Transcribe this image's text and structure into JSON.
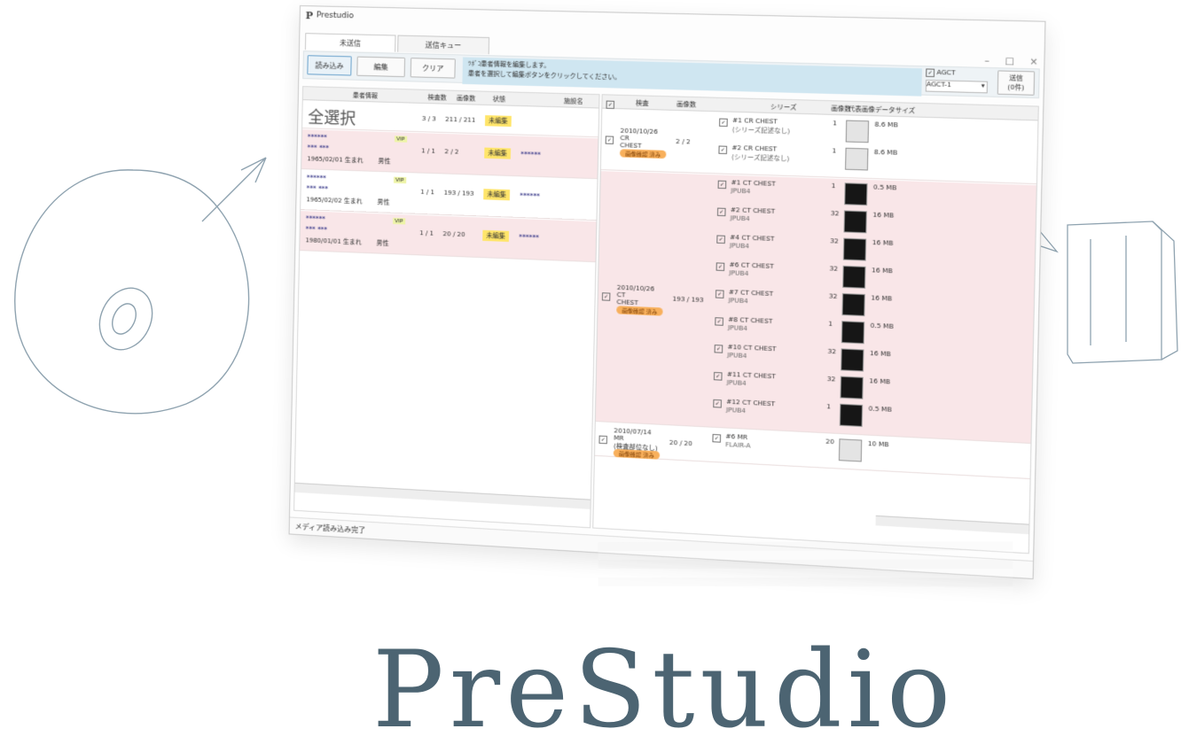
{
  "app": {
    "title": "Prestudio"
  },
  "tabs": [
    {
      "label": "未送信"
    },
    {
      "label": "送信キュー"
    }
  ],
  "window_controls": [
    "–",
    "□",
    "×"
  ],
  "toolbar": {
    "read_label": "読み込み",
    "edit_label": "編集",
    "clear_label": "クリア",
    "message_line1": "ﾂﾎﾞｺ患者情報を編集します。",
    "message_line2": "患者を選択して編集ボタンをクリックしてください。",
    "dest_checkbox_label": "AGCT",
    "dest_value": "AGCT-1",
    "send_label": "送信",
    "send_sub": "(0件)"
  },
  "left": {
    "headers": [
      "患者情報",
      "検査数",
      "画像数",
      "状態",
      "施設名"
    ],
    "select_all": "全選択",
    "select_all_counts": "3 / 3",
    "select_all_images": "211 / 211",
    "select_all_status": "未編集",
    "patients": [
      {
        "masked": "******",
        "name": "*** ***",
        "born": "1965/02/01 生まれ",
        "sex": "男性",
        "tag": "VIP",
        "exams": "1 / 1",
        "images": "2 / 2",
        "status": "未編集",
        "facility": "******"
      },
      {
        "masked": "******",
        "name": "*** ***",
        "born": "1965/02/02 生まれ",
        "sex": "男性",
        "tag": "VIP",
        "exams": "1 / 1",
        "images": "193 / 193",
        "status": "未編集",
        "facility": "******"
      },
      {
        "masked": "******",
        "name": "*** ***",
        "born": "1980/01/01 生まれ",
        "sex": "男性",
        "tag": "VIP",
        "exams": "1 / 1",
        "images": "20 / 20",
        "status": "未編集",
        "facility": "******"
      }
    ]
  },
  "right": {
    "headers": [
      "検査",
      "画像数",
      "シリーズ",
      "画像数",
      "代表画像",
      "データサイズ"
    ],
    "studies": [
      {
        "date": "2010/10/26",
        "mod": "CR",
        "part": "CHEST",
        "badge": "画像確認 済み",
        "images": "2 / 2",
        "series": [
          {
            "name": "#1 CR CHEST",
            "sub": "(シリーズ記述なし)",
            "count": "1",
            "size": "8.6 MB",
            "dark": false
          },
          {
            "name": "#2 CR CHEST",
            "sub": "(シリーズ記述なし)",
            "count": "1",
            "size": "8.6 MB",
            "dark": false
          }
        ]
      },
      {
        "date": "2010/10/26",
        "mod": "CT",
        "part": "CHEST",
        "badge": "画像確認 済み",
        "images": "193 / 193",
        "series": [
          {
            "name": "#1 CT CHEST",
            "sub": "JPUB4",
            "count": "1",
            "size": "0.5 MB",
            "dark": true
          },
          {
            "name": "#2 CT CHEST",
            "sub": "JPUB4",
            "count": "32",
            "size": "16 MB",
            "dark": true
          },
          {
            "name": "#4 CT CHEST",
            "sub": "JPUB4",
            "count": "32",
            "size": "16 MB",
            "dark": true
          },
          {
            "name": "#6 CT CHEST",
            "sub": "JPUB4",
            "count": "32",
            "size": "16 MB",
            "dark": true
          },
          {
            "name": "#7 CT CHEST",
            "sub": "JPUB4",
            "count": "32",
            "size": "16 MB",
            "dark": true
          },
          {
            "name": "#8 CT CHEST",
            "sub": "JPUB4",
            "count": "1",
            "size": "0.5 MB",
            "dark": true
          },
          {
            "name": "#10 CT CHEST",
            "sub": "JPUB4",
            "count": "32",
            "size": "16 MB",
            "dark": true
          },
          {
            "name": "#11 CT CHEST",
            "sub": "JPUB4",
            "count": "32",
            "size": "16 MB",
            "dark": true
          },
          {
            "name": "#12 CT CHEST",
            "sub": "JPUB4",
            "count": "1",
            "size": "0.5 MB",
            "dark": true
          }
        ]
      },
      {
        "date": "2010/07/14",
        "mod": "MR",
        "part": "(検査部位なし)",
        "badge": "画像確認 済み",
        "images": "20 / 20",
        "series": [
          {
            "name": "#6 MR",
            "sub": "FLAIR-A",
            "count": "20",
            "size": "10 MB",
            "dark": false
          }
        ]
      }
    ]
  },
  "status_bar": "メディア読み込み完了",
  "brand": "PreStudio"
}
